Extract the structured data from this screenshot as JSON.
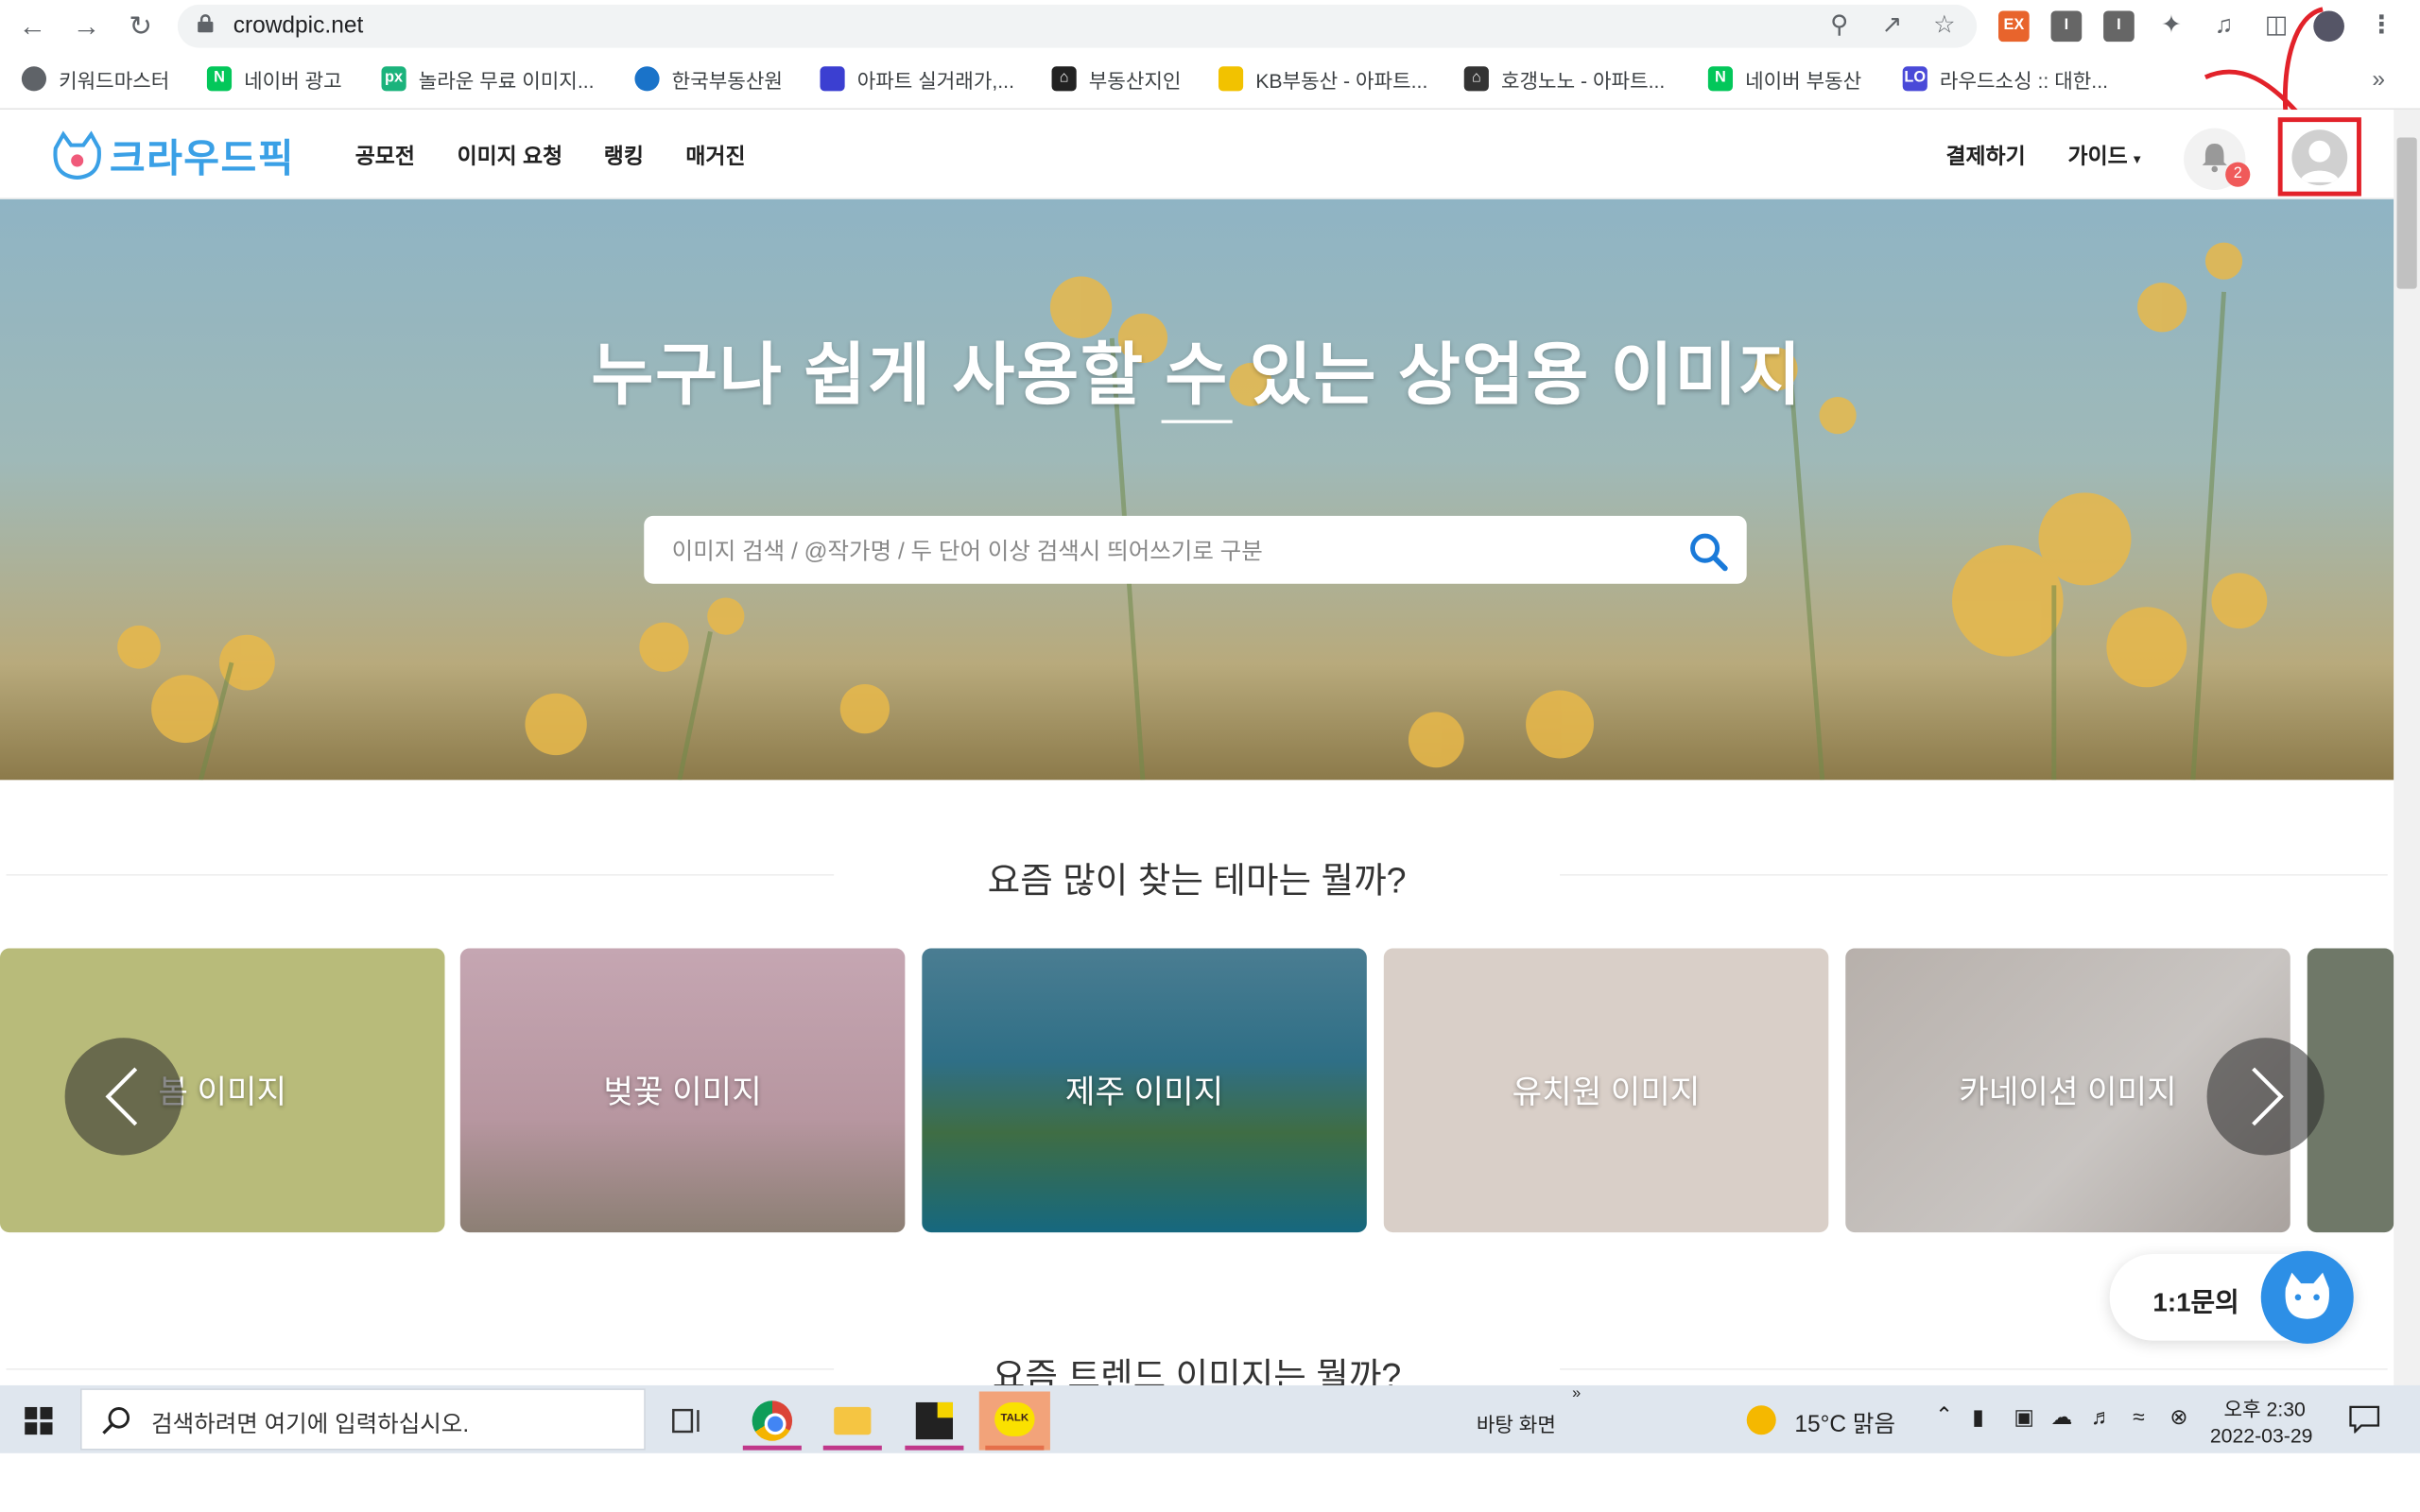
{
  "browser": {
    "url": "crowdpic.net",
    "bookmarks": [
      {
        "label": "키워드마스터",
        "icon": "globe-icon",
        "color": "#5f6368"
      },
      {
        "label": "네이버 광고",
        "icon": "naver-icon",
        "color": "#03c75a"
      },
      {
        "label": "놀라운 무료 이미지...",
        "icon": "px-icon",
        "color": "#1bb37c"
      },
      {
        "label": "한국부동산원",
        "icon": "reb-icon",
        "color": "#1a73c9"
      },
      {
        "label": "아파트 실거래가,...",
        "icon": "apt-icon",
        "color": "#3b3fd1"
      },
      {
        "label": "부동산지인",
        "icon": "house-icon",
        "color": "#222222"
      },
      {
        "label": "KB부동산 - 아파트...",
        "icon": "kb-icon",
        "color": "#f2c200"
      },
      {
        "label": "호갱노노 - 아파트...",
        "icon": "hogang-icon",
        "color": "#333333"
      },
      {
        "label": "네이버 부동산",
        "icon": "naver-icon",
        "color": "#03c75a"
      },
      {
        "label": "라우드소싱 :: 대한...",
        "icon": "loud-icon",
        "color": "#4a4ad8"
      }
    ],
    "more": "»"
  },
  "site": {
    "logo": "크라우드픽",
    "nav": [
      "공모전",
      "이미지 요청",
      "랭킹",
      "매거진"
    ],
    "payment": "결제하기",
    "guide": "가이드",
    "notification_count": "2"
  },
  "hero": {
    "title": "누구나 쉽게 사용할 수 있는 상업용 이미지",
    "search_placeholder": "이미지 검색 / @작가명 / 두 단어 이상 검색시 띄어쓰기로 구분"
  },
  "themes": {
    "heading": "요즘 많이 찾는 테마는 뭘까?",
    "cards": [
      {
        "label": "봄 이미지",
        "color": "#b8bb7a"
      },
      {
        "label": "벚꽃 이미지",
        "color": "#b796a0"
      },
      {
        "label": "제주 이미지",
        "color": "#2f6f86"
      },
      {
        "label": "유치원 이미지",
        "color": "#d9cfc8"
      },
      {
        "label": "카네이션 이미지",
        "color": "#b7b0ab"
      }
    ]
  },
  "trends": {
    "heading": "요즘 트렌드 이미지는 뭘까?"
  },
  "chat": {
    "label": "1:1문의"
  },
  "taskbar": {
    "search_text": "검색하려면 여기에 입력하십시오.",
    "desktop": "바탕 화면",
    "weather": "15°C  맑음",
    "time": "오후 2:30",
    "date": "2022-03-29"
  }
}
